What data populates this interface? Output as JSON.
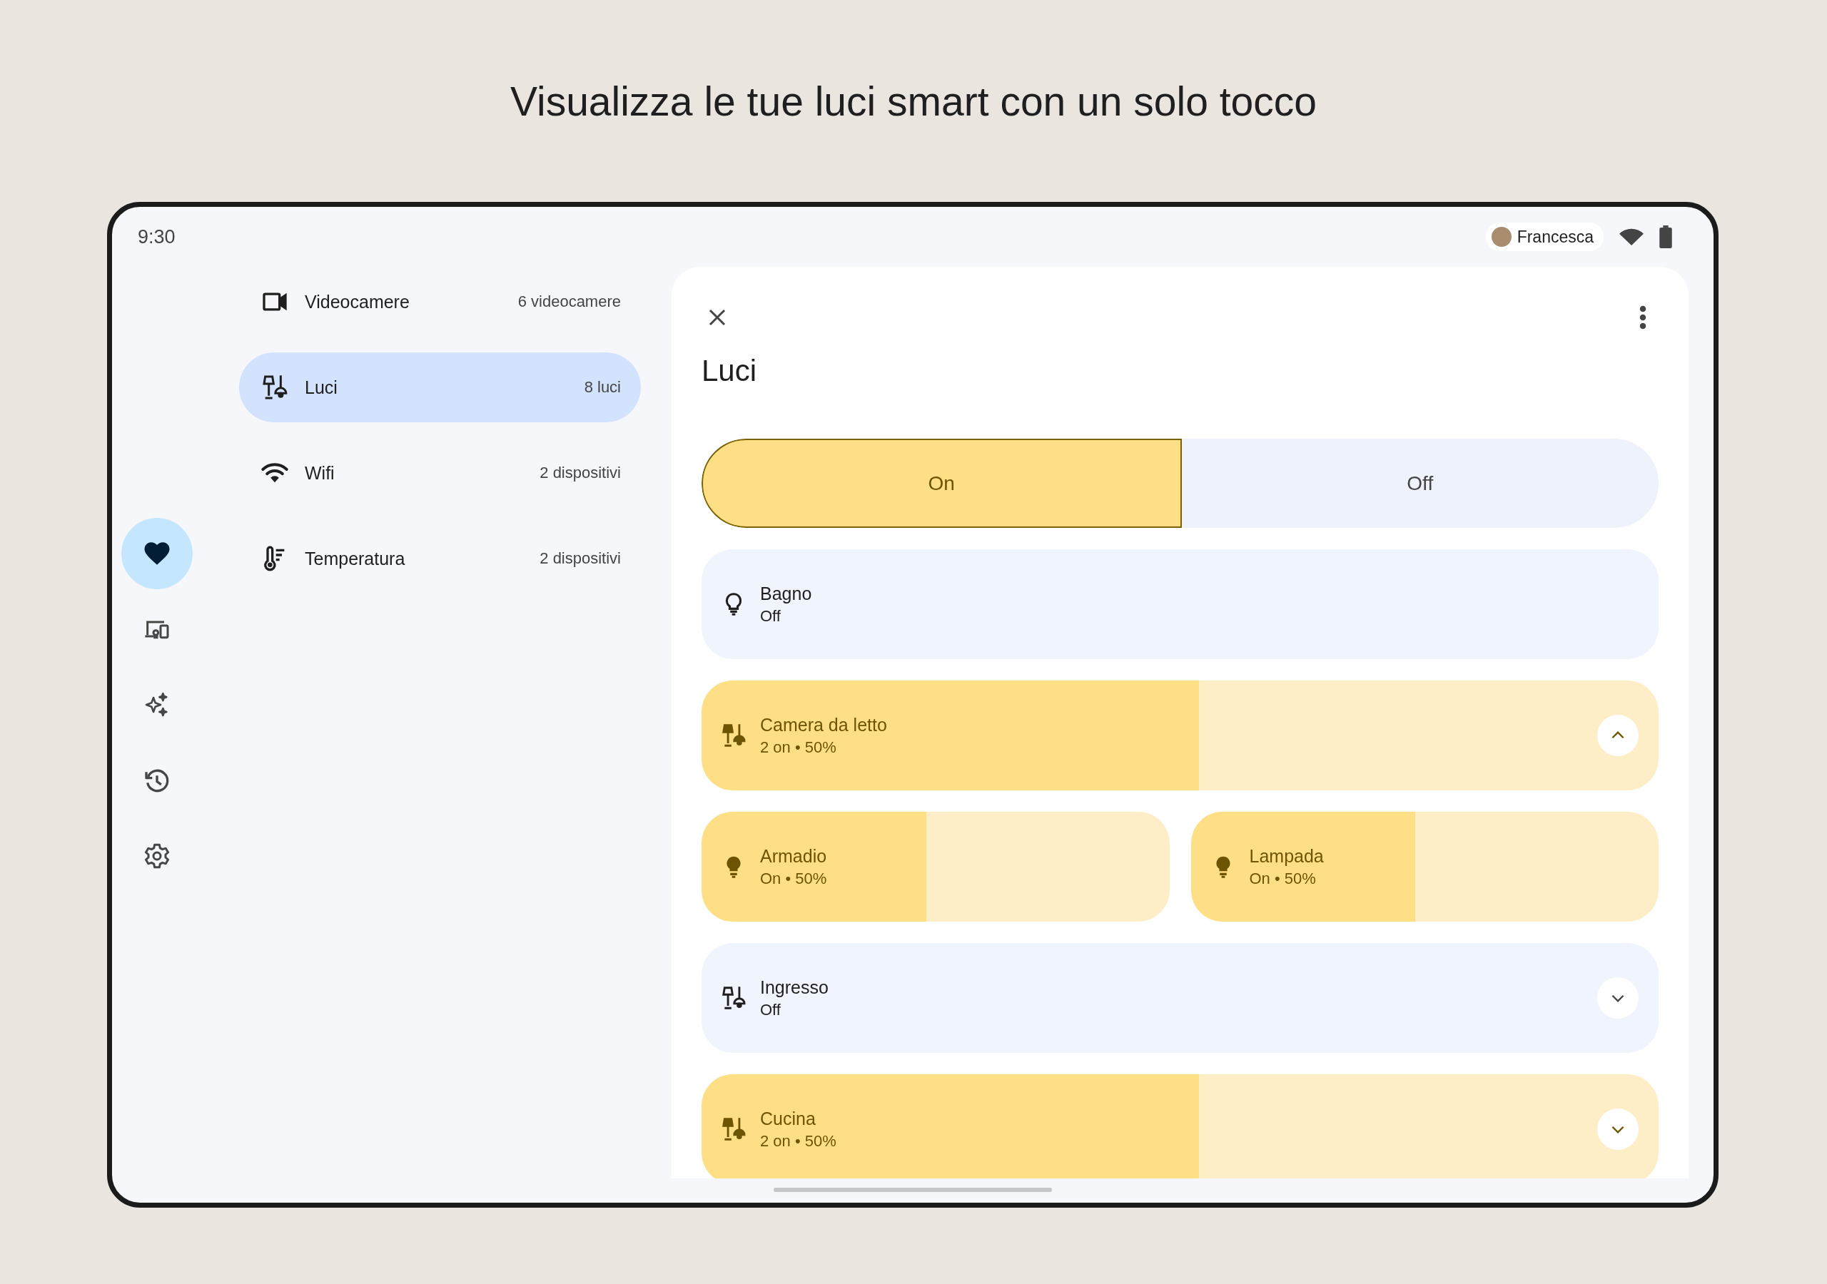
{
  "headline": "Visualizza le tue luci smart con un solo tocco",
  "status_bar": {
    "time": "9:30",
    "user": "Francesca"
  },
  "nav_rail": [
    {
      "kind": "heart",
      "selected": true
    },
    {
      "kind": "devices",
      "selected": false
    },
    {
      "kind": "sparkles",
      "selected": false
    },
    {
      "kind": "history",
      "selected": false
    },
    {
      "kind": "settings",
      "selected": false
    }
  ],
  "categories": [
    {
      "kind": "camera",
      "label": "Videocamere",
      "count": "6 videocamere",
      "selected": false
    },
    {
      "kind": "lamps",
      "label": "Luci",
      "count": "8 luci",
      "selected": true
    },
    {
      "kind": "wifi",
      "label": "Wifi",
      "count": "2 dispositivi",
      "selected": false
    },
    {
      "kind": "thermometer",
      "label": "Temperatura",
      "count": "2 dispositivi",
      "selected": false
    }
  ],
  "panel": {
    "title": "Luci",
    "toggle": [
      {
        "label": "On",
        "selected": true
      },
      {
        "label": "Off",
        "selected": false
      }
    ],
    "rows": [
      {
        "cards": [
          {
            "kind": "bulb",
            "name": "Bagno",
            "status": "Off",
            "on": false
          }
        ]
      },
      {
        "cards": [
          {
            "kind": "lamps",
            "name": "Camera da letto",
            "status": "2 on • 50%",
            "on": true,
            "level": 0.52,
            "expanded": true
          }
        ]
      },
      {
        "cards": [
          {
            "kind": "bulb",
            "name": "Armadio",
            "status": "On • 50%",
            "on": true,
            "level": 0.48
          },
          {
            "kind": "bulb",
            "name": "Lampada",
            "status": "On • 50%",
            "on": true,
            "level": 0.48
          }
        ]
      },
      {
        "cards": [
          {
            "kind": "lamps",
            "name": "Ingresso",
            "status": "Off",
            "on": false,
            "expanded": false
          }
        ]
      },
      {
        "cards": [
          {
            "kind": "lamps",
            "name": "Cucina",
            "status": "2 on • 50%",
            "on": true,
            "level": 0.52,
            "expanded": false
          }
        ]
      }
    ]
  }
}
